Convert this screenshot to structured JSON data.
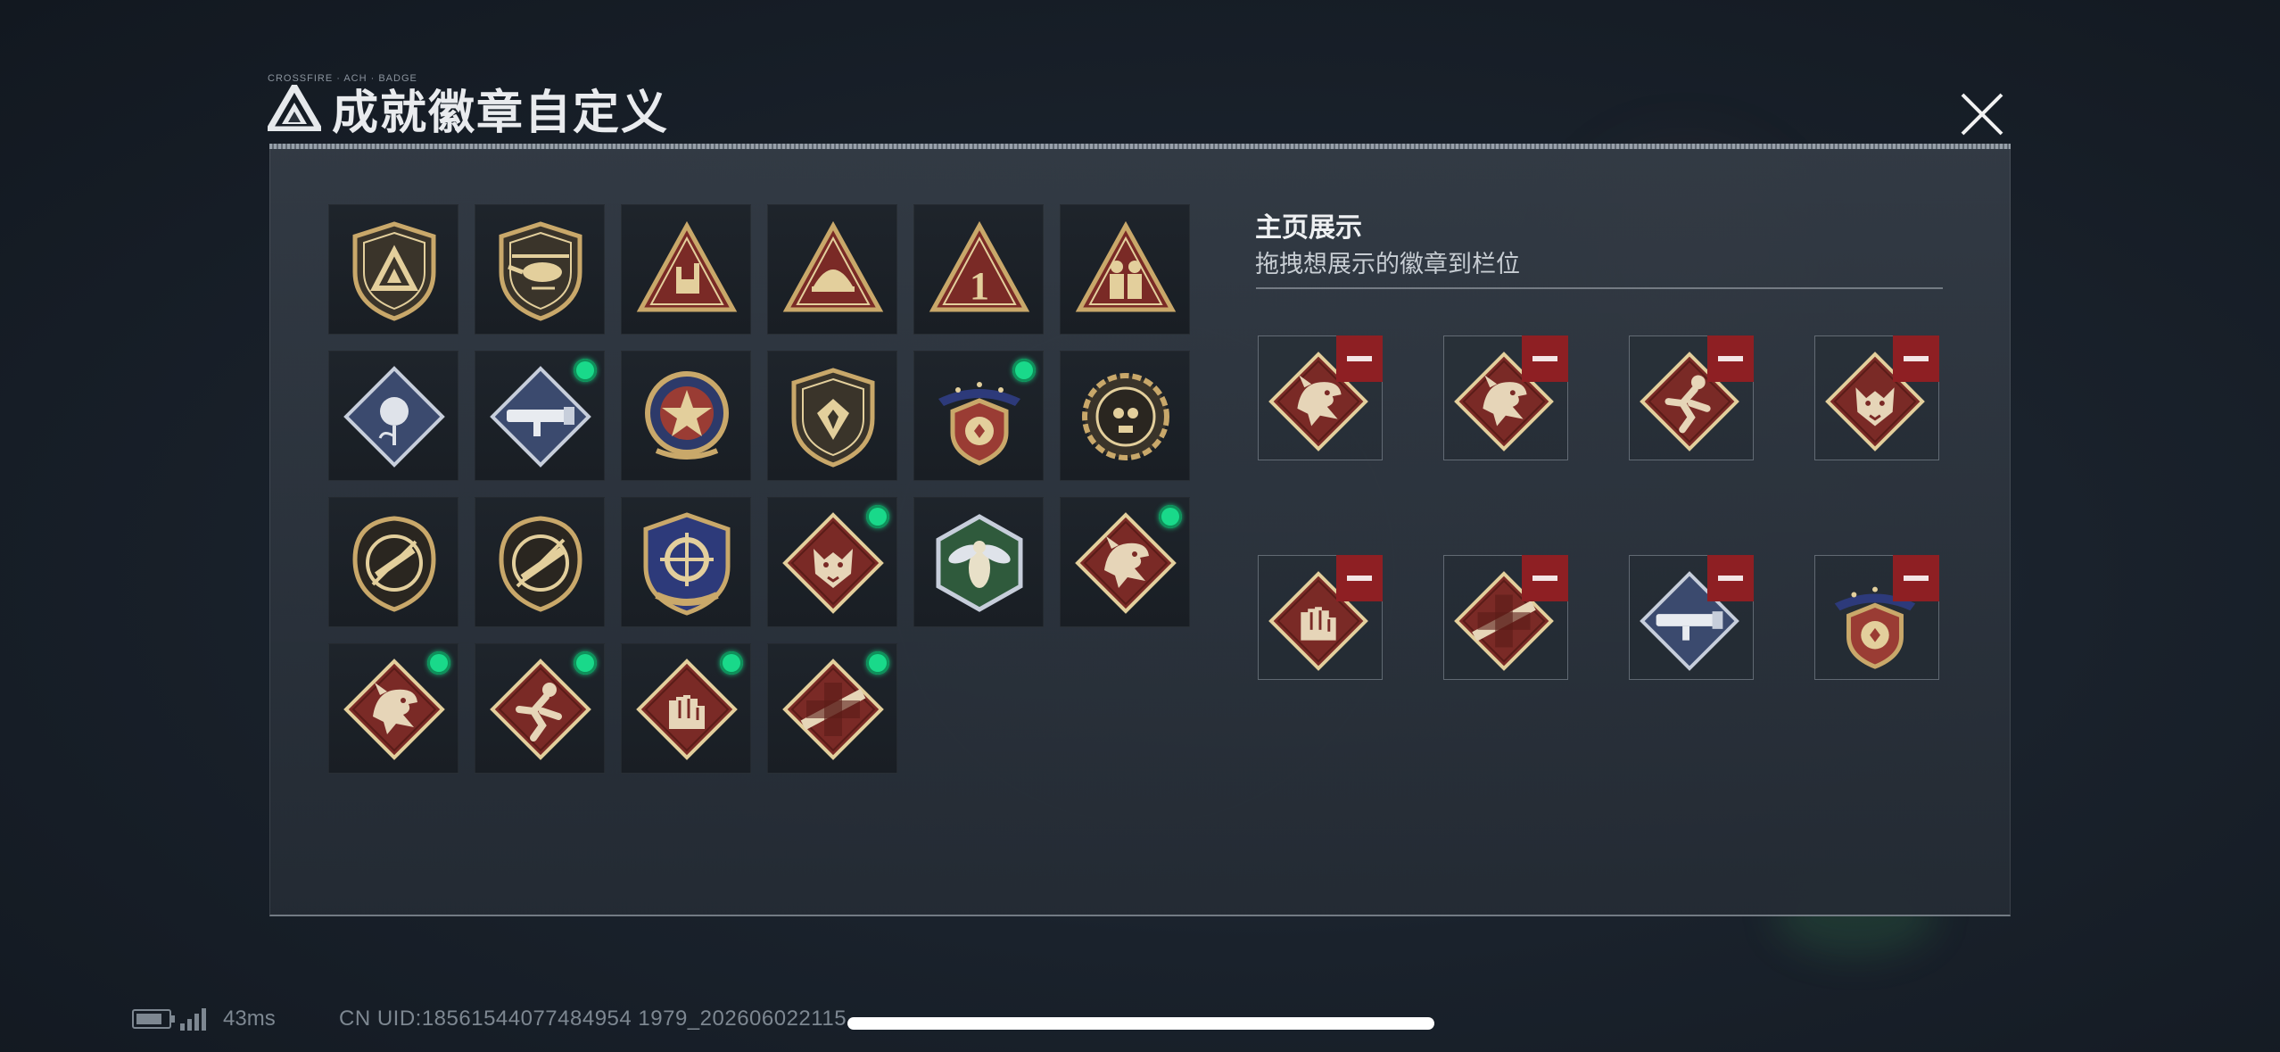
{
  "dialog": {
    "title": "成就徽章自定义",
    "title_small": "CROSSFIRE · ACH · BADGE",
    "close_icon": "close-icon"
  },
  "owned_badges": [
    {
      "icon": "shield-logo-badge",
      "new": false
    },
    {
      "icon": "helicopter-badge",
      "new": false
    },
    {
      "icon": "hang-loose-hand-badge",
      "new": false
    },
    {
      "icon": "helmet-triangle-badge",
      "new": false
    },
    {
      "icon": "number-one-badge",
      "new": false
    },
    {
      "icon": "soldiers-badge",
      "new": false
    },
    {
      "icon": "rose-badge",
      "new": false
    },
    {
      "icon": "rocket-launcher-badge",
      "new": true
    },
    {
      "icon": "star-medal-badge",
      "new": false
    },
    {
      "icon": "guild-shield-badge",
      "new": false
    },
    {
      "icon": "winged-shield-medal-badge",
      "new": true
    },
    {
      "icon": "skull-gear-badge",
      "new": false
    },
    {
      "icon": "assault-rifle-shield-badge",
      "new": false
    },
    {
      "icon": "assault-rifle-shield-badge-2",
      "new": false
    },
    {
      "icon": "crosshair-stars-badge",
      "new": false
    },
    {
      "icon": "wolf-diamond-badge",
      "new": true
    },
    {
      "icon": "wasp-hexagon-badge",
      "new": false
    },
    {
      "icon": "dragon-diamond-badge",
      "new": true
    },
    {
      "icon": "dragon-diamond-badge",
      "new": true
    },
    {
      "icon": "sprinter-diamond-badge",
      "new": true
    },
    {
      "icon": "fist-diamond-badge",
      "new": true
    },
    {
      "icon": "rifle-cross-diamond-badge",
      "new": true
    }
  ],
  "homepage": {
    "title": "主页展示",
    "subtitle": "拖拽想展示的徽章到栏位",
    "slots": [
      {
        "icon": "dragon-diamond-badge"
      },
      {
        "icon": "dragon-diamond-badge"
      },
      {
        "icon": "sprinter-diamond-badge"
      },
      {
        "icon": "wolf-diamond-badge"
      },
      {
        "icon": "fist-diamond-badge"
      },
      {
        "icon": "rifle-cross-diamond-badge"
      },
      {
        "icon": "rocket-launcher-badge"
      },
      {
        "icon": "winged-shield-medal-badge"
      }
    ]
  },
  "status_bar": {
    "ping": "43ms",
    "uid": "CN UID:18561544077484954197 9_20260602211 5",
    "uid_display": "CN UID:18561544077484954 1979_202606022115"
  },
  "colors": {
    "accent_new": "#19d98a",
    "remove_red": "#8e1f23",
    "gold": "#c9a86a",
    "crimson": "#7a2a26"
  }
}
